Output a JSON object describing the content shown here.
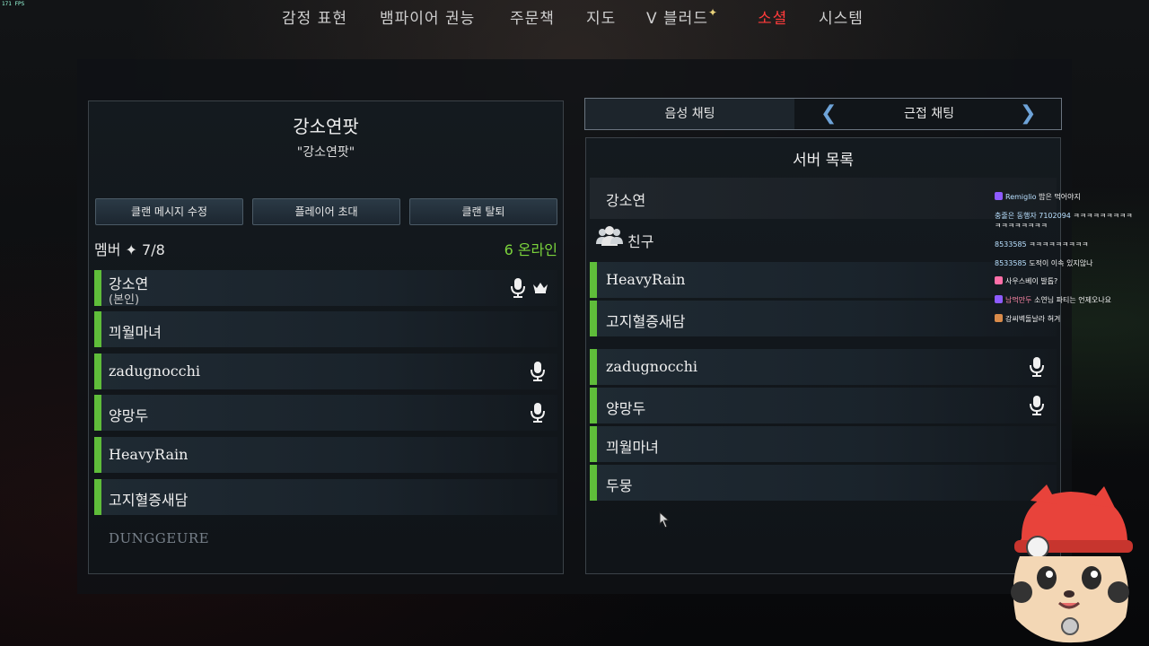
{
  "fps": "171 FPS",
  "nav": {
    "tabs": [
      "감정 표현",
      "뱀파이어 권능",
      "주문책",
      "지도",
      "V 블러드",
      "소셜",
      "시스템"
    ],
    "active": "소셜",
    "spark_icon": "sparkle-icon"
  },
  "clan": {
    "name": "강소연팟",
    "message": "\"강소연팟\"",
    "buttons": [
      "클랜 메시지 수정",
      "플레이어 초대",
      "클랜 탈퇴"
    ],
    "members_label": "멤버 ✦ 7/8",
    "online_label": "6 온라인",
    "members": [
      {
        "name": "강소연",
        "sub": "(본인)",
        "mic": true,
        "crown": true
      },
      {
        "name": "끠월마녀",
        "mic": false
      },
      {
        "name": "zadugnocchi",
        "mic": true
      },
      {
        "name": "양망두",
        "mic": true
      },
      {
        "name": "HeavyRain",
        "mic": false
      },
      {
        "name": "고지혈증새담",
        "mic": false
      }
    ],
    "offline_member": "DUNGGEURE"
  },
  "chat_mode": {
    "voice": "음성 채팅",
    "proximity": "근접 채팅"
  },
  "server": {
    "title": "서버 목록",
    "self": "강소연",
    "friends_label": "친구",
    "friends": [
      "HeavyRain",
      "고지혈증새담"
    ],
    "others": [
      {
        "name": "zadugnocchi",
        "mic": true
      },
      {
        "name": "양망두",
        "mic": true
      },
      {
        "name": "끠월마녀",
        "mic": false
      },
      {
        "name": "두뭉",
        "mic": false
      }
    ]
  },
  "stream_chat": [
    {
      "nick": "Remiglio",
      "text": "밥은 먹어야지"
    },
    {
      "nick": "충줄은 동행자 7102094",
      "text": "ㅋㅋㅋㅋㅋㅋㅋㅋㅋ ㅋㅋㅋㅋㅋㅋㅋㅋ"
    },
    {
      "nick": "8533585",
      "text": "ㅋㅋㅋㅋㅋㅋㅋㅋㅋ"
    },
    {
      "nick": "8533585",
      "text": "도적이 이속 있지않나"
    },
    {
      "nick": "",
      "text": "사우스베이 발톱?"
    },
    {
      "nick": "남먹만두",
      "text": "소연님 파티는 언제오나요"
    },
    {
      "nick": "",
      "text": "강씨벽돌날라 혀겨"
    }
  ],
  "colors": {
    "active_tab": "#ff3b3b",
    "online": "#7bd43c",
    "member_bar": "#5fbd3a",
    "chevron": "#6ea3d8"
  }
}
